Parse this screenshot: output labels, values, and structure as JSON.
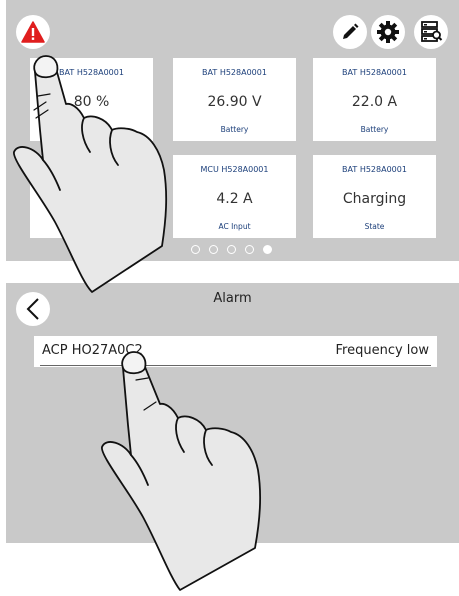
{
  "dashboard": {
    "tiles": [
      {
        "head": "BAT H528A0001",
        "value": "80 %",
        "foot": ""
      },
      {
        "head": "BAT H528A0001",
        "value": "26.90 V",
        "foot": "Battery"
      },
      {
        "head": "BAT H528A0001",
        "value": "22.0 A",
        "foot": "Battery"
      },
      {
        "head": "",
        "value": "",
        "foot": ""
      },
      {
        "head": "MCU H528A0001",
        "value": "4.2 A",
        "foot": "AC Input"
      },
      {
        "head": "BAT H528A0001",
        "value": "Charging",
        "foot": "State"
      }
    ],
    "page_dots": {
      "count": 5,
      "active_index": 4
    },
    "icons": [
      "alarm-warning-icon",
      "pencil-icon",
      "gear-icon",
      "device-list-icon"
    ],
    "colors": {
      "panel": "#c9c9c9",
      "alarm": "#e01e1e",
      "tile_text": "#1c3f7a"
    }
  },
  "alarm": {
    "title": "Alarm",
    "entries": [
      {
        "source": "ACP HO27A0C2",
        "message": "Frequency low"
      }
    ],
    "icons": [
      "back-chevron-icon"
    ]
  }
}
